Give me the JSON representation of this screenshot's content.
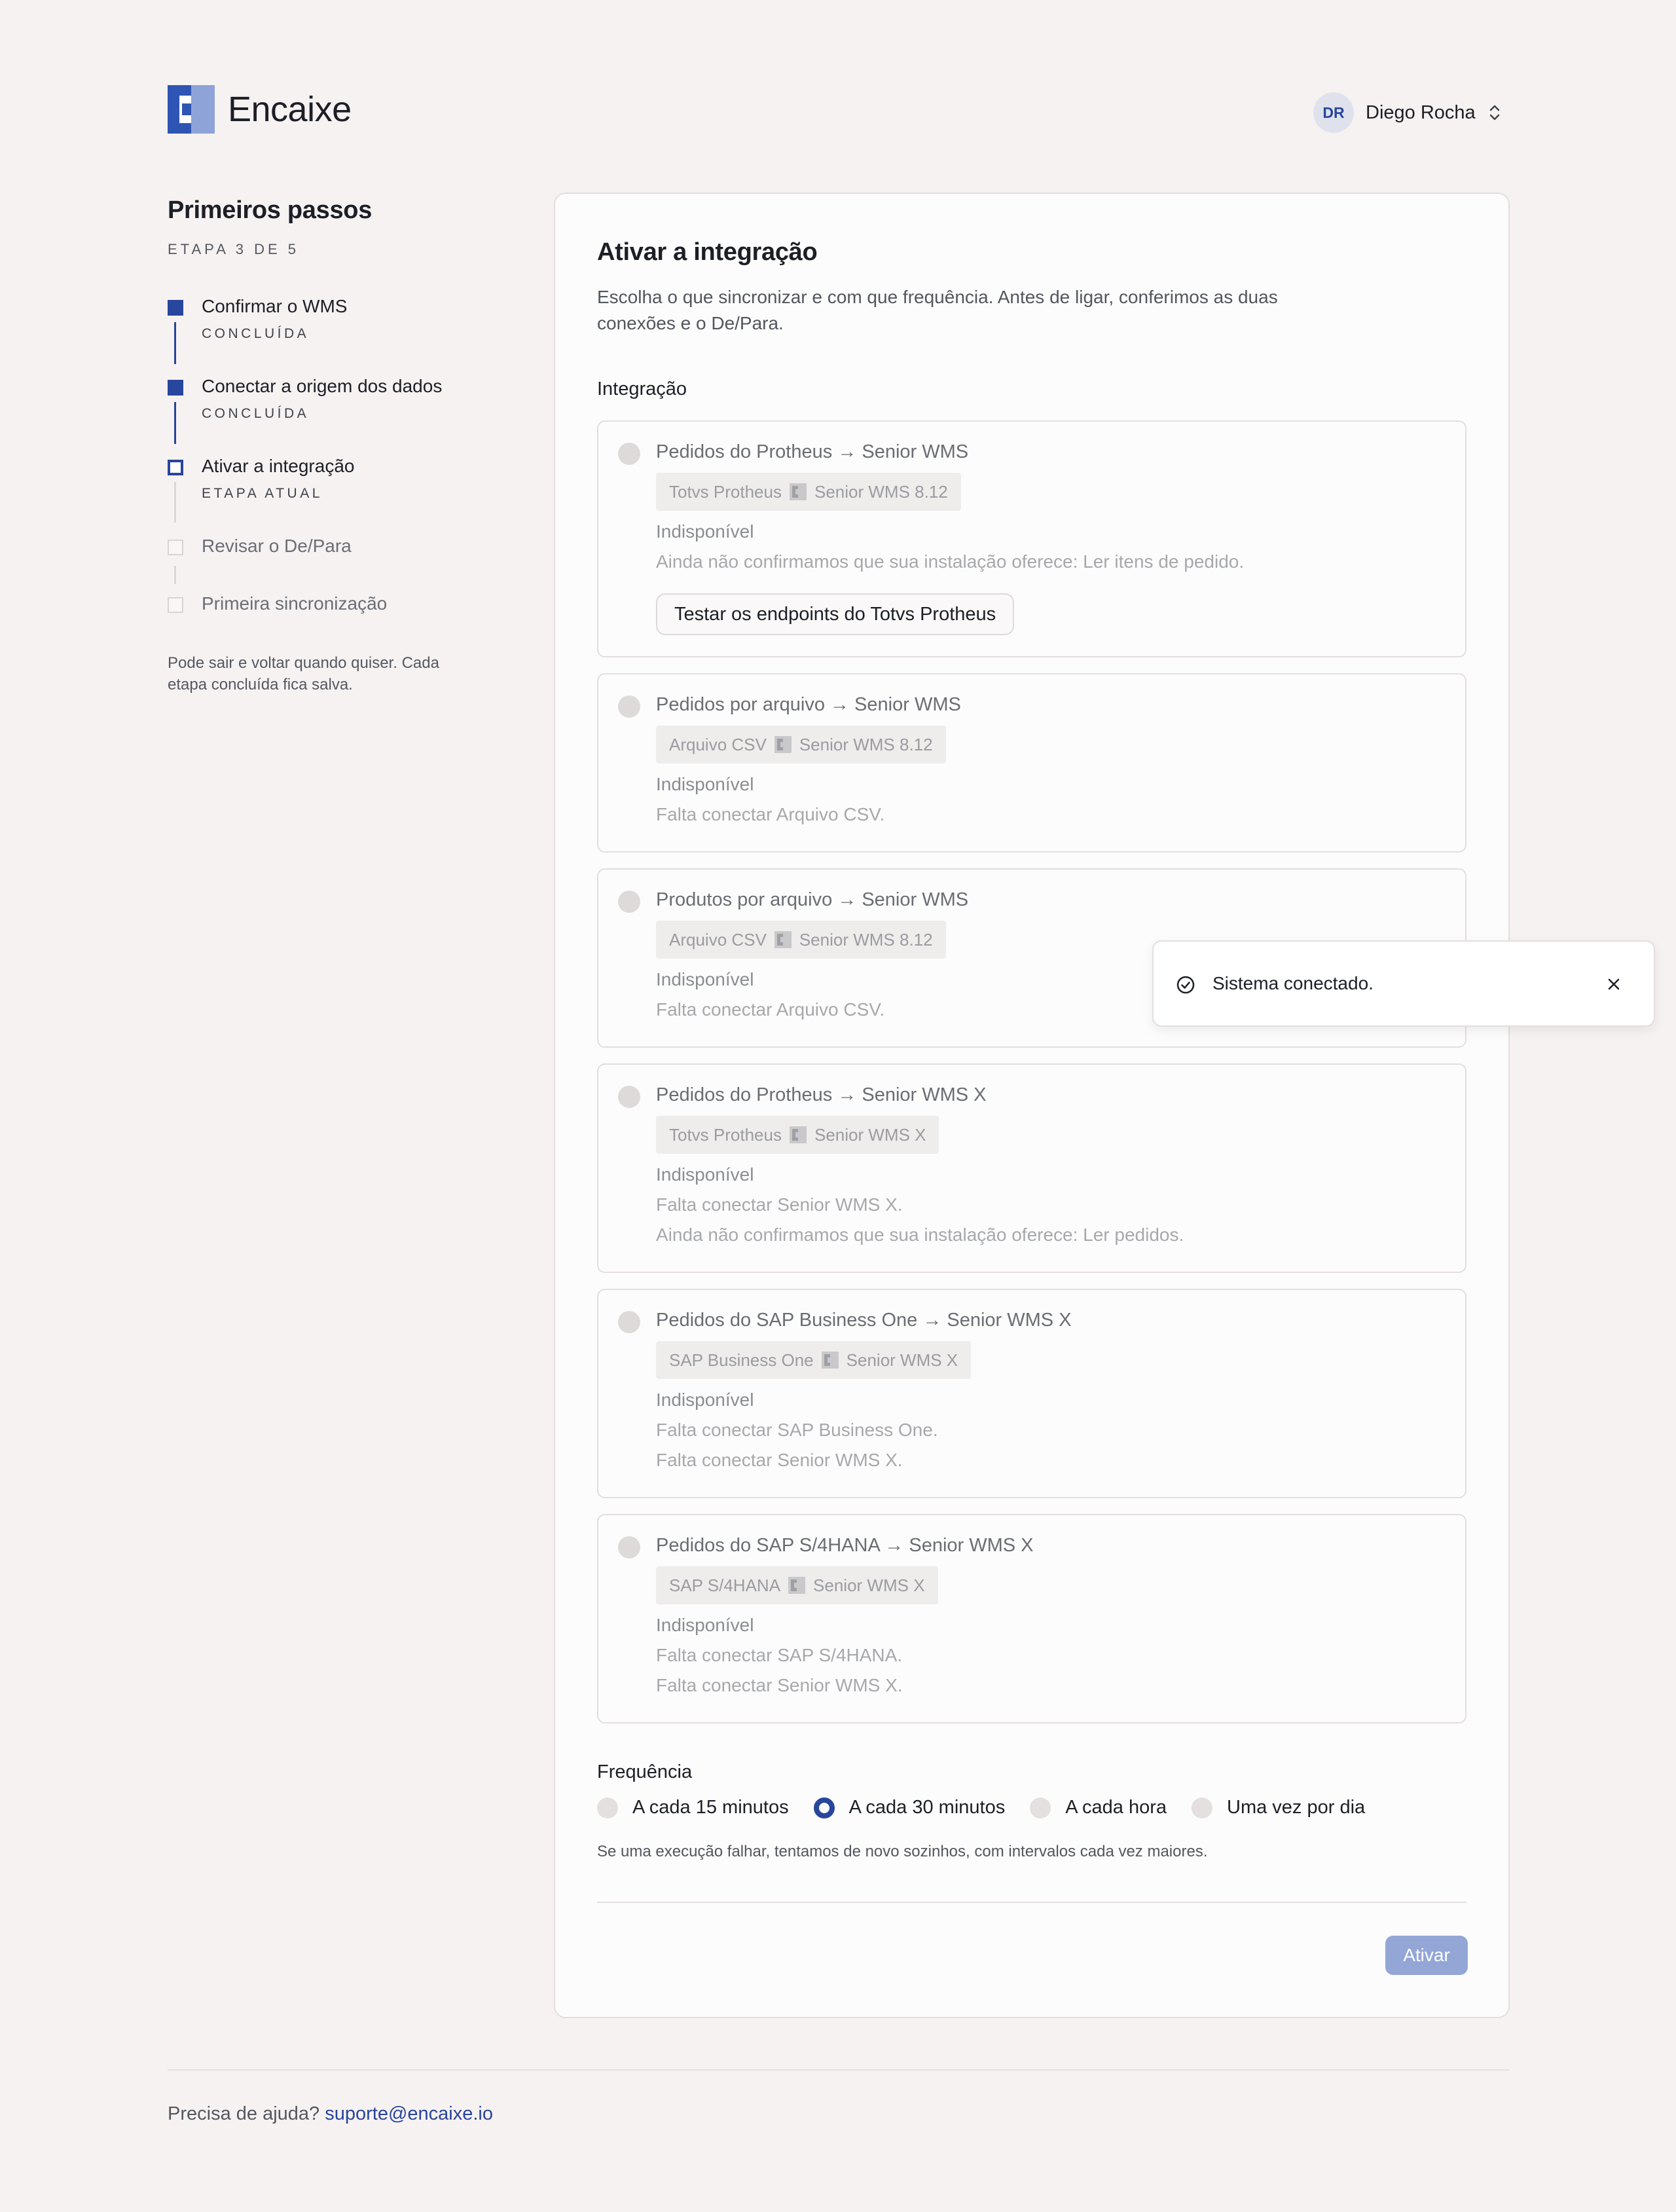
{
  "app": {
    "name": "Encaixe"
  },
  "user": {
    "initials": "DR",
    "name": "Diego Rocha"
  },
  "sidebar": {
    "title": "Primeiros passos",
    "step_indicator": "ETAPA 3 DE 5",
    "steps": [
      {
        "label": "Confirmar o WMS",
        "status_label": "CONCLUÍDA",
        "state": "done"
      },
      {
        "label": "Conectar a origem dos dados",
        "status_label": "CONCLUÍDA",
        "state": "done"
      },
      {
        "label": "Ativar a integração",
        "status_label": "ETAPA ATUAL",
        "state": "current"
      },
      {
        "label": "Revisar o De/Para",
        "status_label": "",
        "state": "pending"
      },
      {
        "label": "Primeira sincronização",
        "status_label": "",
        "state": "pending"
      }
    ],
    "note": "Pode sair e voltar quando quiser. Cada etapa concluída fica salva."
  },
  "main": {
    "title": "Ativar a integração",
    "description": "Escolha o que sincronizar e com que frequência. Antes de ligar, conferimos as duas conexões e o De/Para.",
    "integration_label": "Integração",
    "integrations": [
      {
        "title": "Pedidos do Protheus → Senior WMS",
        "source": "Totvs Protheus",
        "target": "Senior WMS 8.12",
        "status": "Indisponível",
        "reasons": [
          "Ainda não confirmamos que sua instalação oferece: Ler itens de pedido."
        ],
        "button": "Testar os endpoints do Totvs Protheus"
      },
      {
        "title": "Pedidos por arquivo → Senior WMS",
        "source": "Arquivo CSV",
        "target": "Senior WMS 8.12",
        "status": "Indisponível",
        "reasons": [
          "Falta conectar Arquivo CSV."
        ]
      },
      {
        "title": "Produtos por arquivo → Senior WMS",
        "source": "Arquivo CSV",
        "target": "Senior WMS 8.12",
        "status": "Indisponível",
        "reasons": [
          "Falta conectar Arquivo CSV."
        ]
      },
      {
        "title": "Pedidos do Protheus → Senior WMS X",
        "source": "Totvs Protheus",
        "target": "Senior WMS X",
        "status": "Indisponível",
        "reasons": [
          "Falta conectar Senior WMS X.",
          "Ainda não confirmamos que sua instalação oferece: Ler pedidos."
        ]
      },
      {
        "title": "Pedidos do SAP Business One → Senior WMS X",
        "source": "SAP Business One",
        "target": "Senior WMS X",
        "status": "Indisponível",
        "reasons": [
          "Falta conectar SAP Business One.",
          "Falta conectar Senior WMS X."
        ]
      },
      {
        "title": "Pedidos do SAP S/4HANA → Senior WMS X",
        "source": "SAP S/4HANA",
        "target": "Senior WMS X",
        "status": "Indisponível",
        "reasons": [
          "Falta conectar SAP S/4HANA.",
          "Falta conectar Senior WMS X."
        ]
      }
    ],
    "frequency": {
      "label": "Frequência",
      "options": [
        "A cada 15 minutos",
        "A cada 30 minutos",
        "A cada hora",
        "Uma vez por dia"
      ],
      "selected": "A cada 30 minutos",
      "note": "Se uma execução falhar, tentamos de novo sozinhos, com intervalos cada vez maiores."
    },
    "activate_label": "Ativar"
  },
  "toast": {
    "message": "Sistema conectado.",
    "icon": "check-circle-icon",
    "close_icon": "close-icon"
  },
  "footer": {
    "text": "Precisa de ajuda?",
    "email": "suporte@encaixe.io"
  },
  "colors": {
    "accent": "#27469c",
    "background": "#f7f2f2",
    "button_disabled": "#93a6d6"
  }
}
